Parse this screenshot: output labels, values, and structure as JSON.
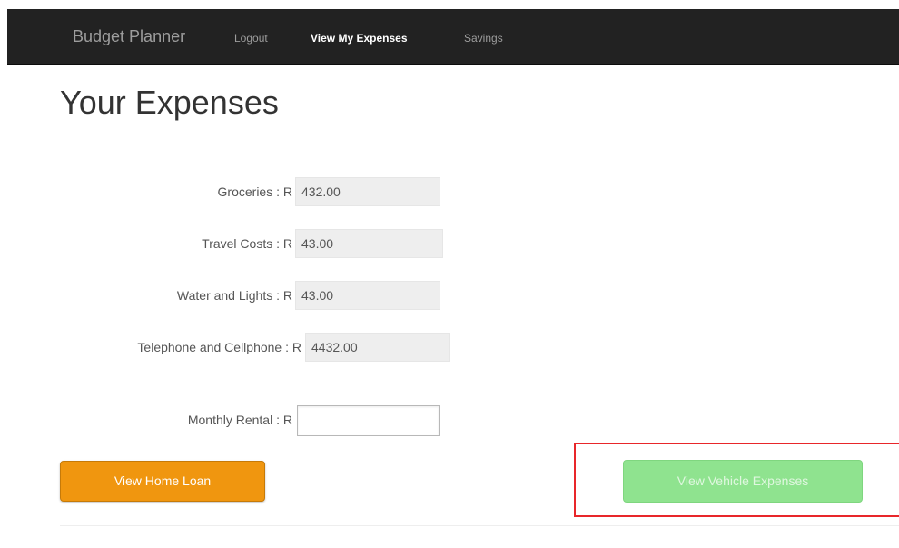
{
  "navbar": {
    "brand": "Budget Planner",
    "links": [
      {
        "label": "Logout",
        "active": false
      },
      {
        "label": "View My Expenses",
        "active": true
      },
      {
        "label": "Savings",
        "active": false
      }
    ]
  },
  "page": {
    "title": "Your Expenses"
  },
  "expenses": [
    {
      "label": "Groceries : R",
      "value": "432.00"
    },
    {
      "label": "Travel Costs : R",
      "value": "43.00"
    },
    {
      "label": "Water and Lights : R",
      "value": "43.00"
    },
    {
      "label": "Telephone and Cellphone : R",
      "value": "4432.00"
    }
  ],
  "rental": {
    "label": "Monthly Rental : R",
    "value": ""
  },
  "buttons": {
    "home_loan": "View Home Loan",
    "vehicle_expenses": "View Vehicle Expenses"
  },
  "colors": {
    "navbar_bg": "#222222",
    "home_loan_button": "#f0960f",
    "vehicle_button": "#8fe38f",
    "highlight_border": "#e8262a"
  }
}
